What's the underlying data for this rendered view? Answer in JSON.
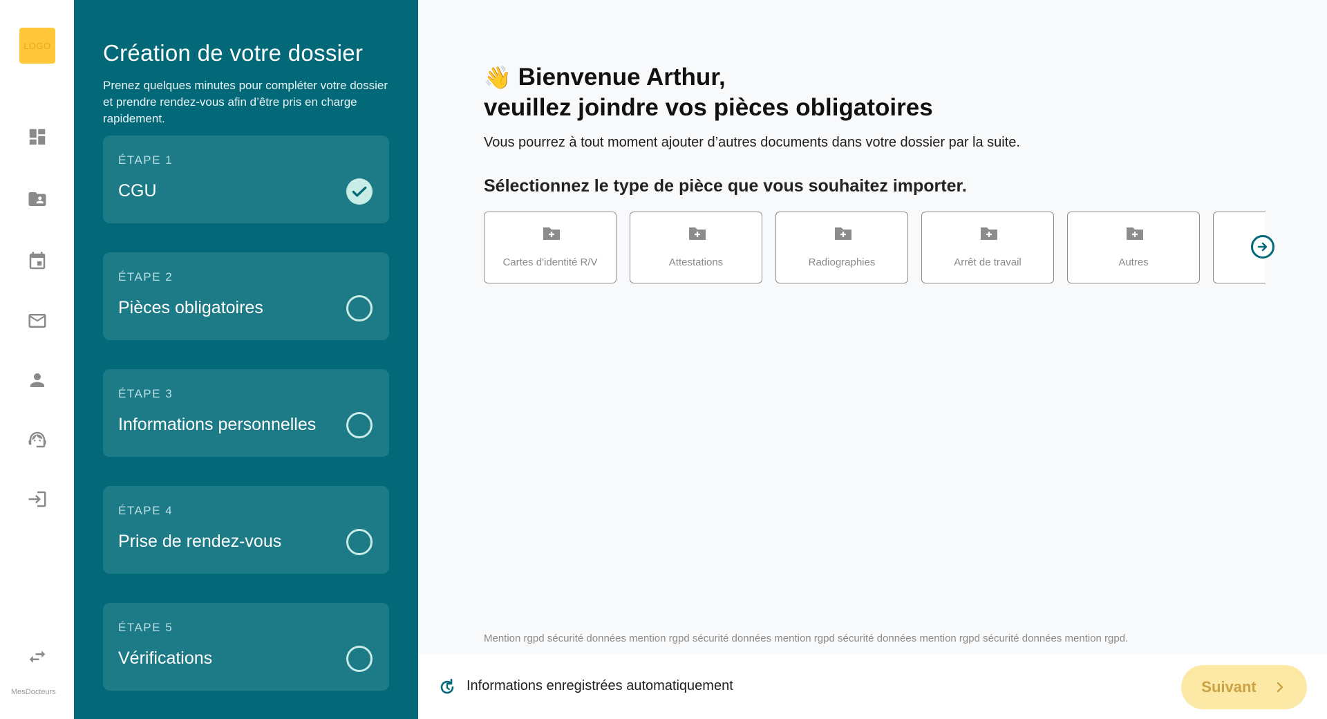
{
  "sidebar": {
    "logo_text": "LOGO",
    "brand": "MesDocteurs",
    "icons": [
      "dashboard-icon",
      "folder-shared-icon",
      "calendar-icon",
      "mail-icon",
      "person-icon",
      "support-agent-icon",
      "login-icon",
      "swap-arrows-icon"
    ]
  },
  "steps": {
    "title": "Création de votre dossier",
    "description": "Prenez quelques minutes pour compléter votre dossier et prendre rendez-vous afin d’être pris en charge rapidement.",
    "items": [
      {
        "label": "ÉTAPE 1",
        "name": "CGU",
        "status": "done"
      },
      {
        "label": "ÉTAPE 2",
        "name": "Pièces obligatoires",
        "status": "todo"
      },
      {
        "label": "ÉTAPE 3",
        "name": "Informations personnelles",
        "status": "todo"
      },
      {
        "label": "ÉTAPE 4",
        "name": "Prise de rendez-vous",
        "status": "todo"
      },
      {
        "label": "ÉTAPE 5",
        "name": "Vérifications",
        "status": "todo"
      }
    ]
  },
  "main": {
    "greeting_emoji": "👋",
    "greeting_line1": "Bienvenue Arthur,",
    "greeting_line2": "veuillez joindre vos pièces obligatoires",
    "subtitle": "Vous pourrez à tout moment ajouter d’autres documents dans votre dossier par la suite.",
    "select_title": "Sélectionnez le type de pièce que vous souhaitez importer.",
    "doc_types": [
      "Cartes d'identité R/V",
      "Attestations",
      "Radiographies",
      "Arrêt de travail",
      "Autres",
      ""
    ],
    "rgpd": "Mention rgpd sécurité données mention rgpd sécurité données mention rgpd sécurité données mention rgpd sécurité données mention rgpd."
  },
  "footer": {
    "autosave_text": "Informations enregistrées automatiquement",
    "next_label": "Suivant"
  },
  "colors": {
    "panel": "#036978",
    "card": "#1d7a87",
    "status": "#c8ece6",
    "logo": "#ffc83a",
    "next_button": "#fde9a6"
  }
}
